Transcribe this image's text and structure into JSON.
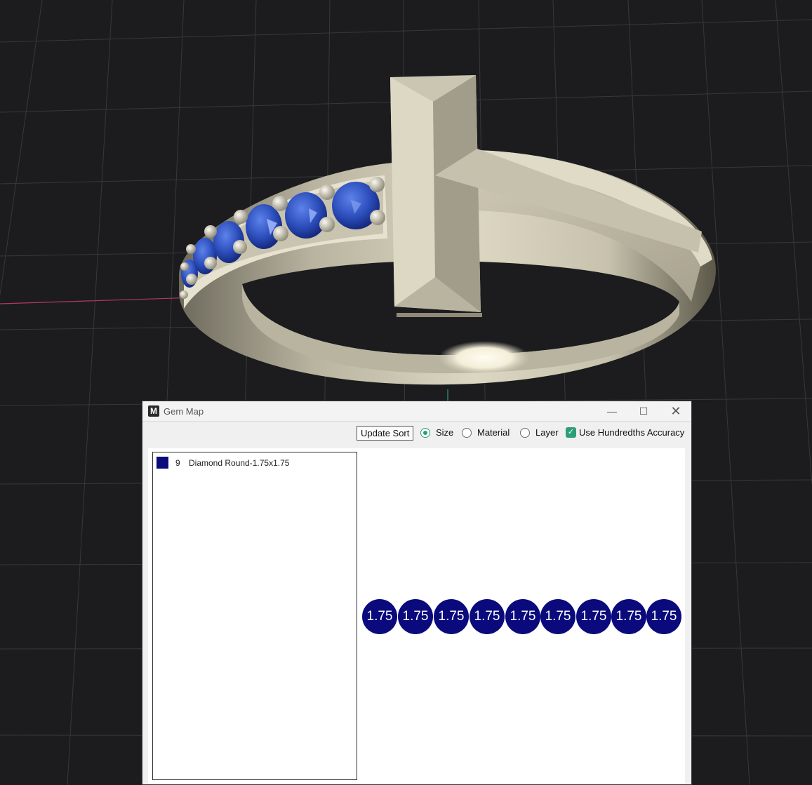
{
  "window": {
    "title": "Gem Map",
    "app_icon": "M",
    "controls": {
      "minimize": "—",
      "maximize": "☐",
      "close": "✕"
    }
  },
  "toolbar": {
    "update_button": "Update Sort",
    "sort_options": [
      {
        "label": "Size",
        "checked": true
      },
      {
        "label": "Material",
        "checked": false
      },
      {
        "label": "Layer",
        "checked": false
      }
    ],
    "hundredths_label": "Use Hundredths Accuracy",
    "hundredths_checked": true,
    "check_glyph": "✓"
  },
  "gem_list": [
    {
      "count": "9",
      "name": "Diamond Round-1.75x1.75",
      "color": "#0a0a7c"
    }
  ],
  "gem_map": {
    "gems": [
      "1.75",
      "1.75",
      "1.75",
      "1.75",
      "1.75",
      "1.75",
      "1.75",
      "1.75",
      "1.75"
    ],
    "color": "#0a0a7c"
  },
  "colors": {
    "viewport_bg": "#1c1c1e",
    "accent": "#2c9f78",
    "metal": "#d8d3bf",
    "sapphire": "#2f52c4"
  }
}
